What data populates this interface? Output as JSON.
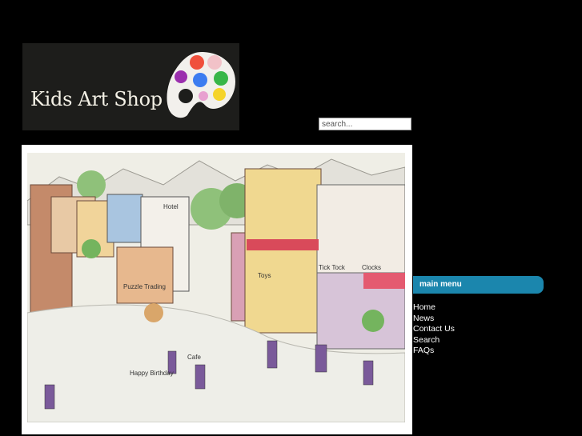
{
  "brand": {
    "name": "Kids Art Shop",
    "palette_colors": [
      "#f0503c",
      "#9b2fae",
      "#3c7cf0",
      "#38b648",
      "#f5d42a",
      "#f2c2c8"
    ]
  },
  "search": {
    "placeholder": "search...",
    "value": ""
  },
  "main_menu": {
    "title": "main menu",
    "accent_color": "#1b86ad",
    "items": [
      {
        "label": "Home"
      },
      {
        "label": "News"
      },
      {
        "label": "Contact Us"
      },
      {
        "label": "Search"
      },
      {
        "label": "FAQs"
      }
    ]
  },
  "artwork": {
    "signs": [
      "Hotel",
      "Puzzle Trading",
      "Toys",
      "Tick Tock",
      "Clocks",
      "Happy Birthday",
      "Cafe"
    ]
  }
}
